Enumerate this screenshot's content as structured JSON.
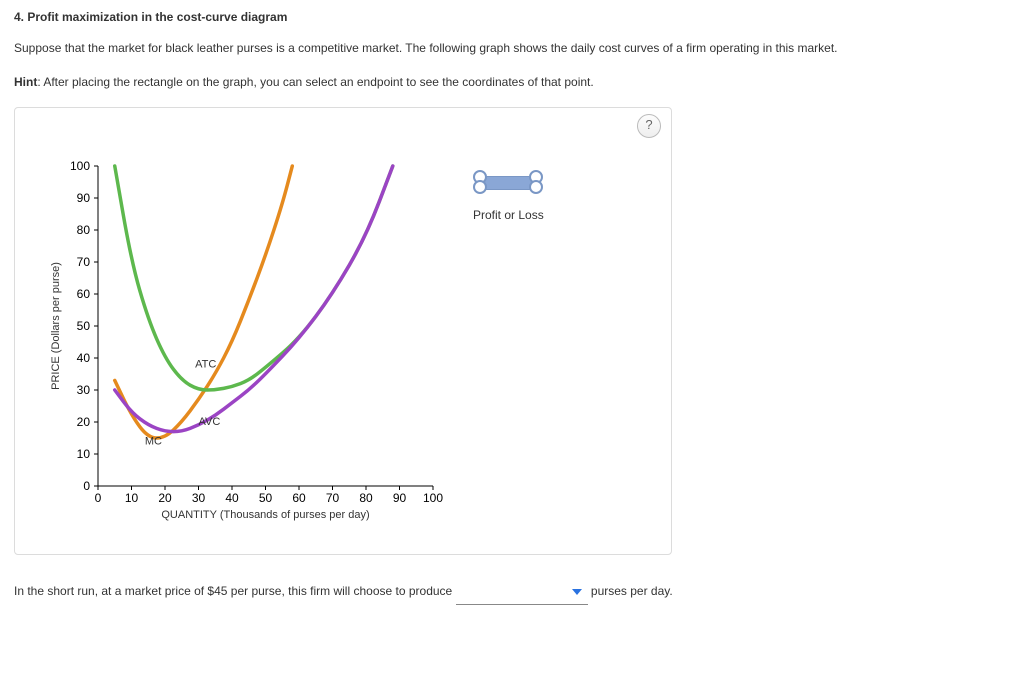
{
  "question": {
    "number_title": "4. Profit maximization in the cost-curve diagram",
    "prompt": "Suppose that the market for black leather purses is a competitive market. The following graph shows the daily cost curves of a firm operating in this market.",
    "hint_label": "Hint",
    "hint_text": ": After placing the rectangle on the graph, you can select an endpoint to see the coordinates of that point."
  },
  "help_btn": "?",
  "legend": {
    "label": "Profit or Loss"
  },
  "answer": {
    "before": "In the short run, at a market price of $45 per purse, this firm will choose to produce ",
    "after": " purses per day."
  },
  "chart_data": {
    "type": "line",
    "title": "",
    "xlabel": "QUANTITY (Thousands of purses per day)",
    "ylabel": "PRICE (Dollars per purse)",
    "xlim": [
      0,
      100
    ],
    "ylim": [
      0,
      100
    ],
    "x_ticks": [
      0,
      10,
      20,
      30,
      40,
      50,
      60,
      70,
      80,
      90,
      100
    ],
    "y_ticks": [
      0,
      10,
      20,
      30,
      40,
      50,
      60,
      70,
      80,
      90,
      100
    ],
    "series": [
      {
        "name": "MC",
        "color": "#e58a1e",
        "points": [
          {
            "x": 5,
            "y": 33
          },
          {
            "x": 10,
            "y": 22
          },
          {
            "x": 15,
            "y": 15
          },
          {
            "x": 20,
            "y": 15
          },
          {
            "x": 25,
            "y": 20
          },
          {
            "x": 30,
            "y": 27
          },
          {
            "x": 35,
            "y": 35
          },
          {
            "x": 40,
            "y": 45
          },
          {
            "x": 45,
            "y": 58
          },
          {
            "x": 50,
            "y": 72
          },
          {
            "x": 55,
            "y": 88
          },
          {
            "x": 58,
            "y": 100
          }
        ]
      },
      {
        "name": "ATC",
        "color": "#5db84d",
        "points": [
          {
            "x": 5,
            "y": 100
          },
          {
            "x": 10,
            "y": 70
          },
          {
            "x": 15,
            "y": 52
          },
          {
            "x": 20,
            "y": 40
          },
          {
            "x": 25,
            "y": 33
          },
          {
            "x": 30,
            "y": 30
          },
          {
            "x": 35,
            "y": 30
          },
          {
            "x": 40,
            "y": 31
          },
          {
            "x": 45,
            "y": 33
          },
          {
            "x": 50,
            "y": 37
          },
          {
            "x": 60,
            "y": 46
          },
          {
            "x": 70,
            "y": 60
          },
          {
            "x": 80,
            "y": 78
          },
          {
            "x": 88,
            "y": 100
          }
        ]
      },
      {
        "name": "AVC",
        "color": "#9b44c4",
        "points": [
          {
            "x": 5,
            "y": 30
          },
          {
            "x": 10,
            "y": 23
          },
          {
            "x": 15,
            "y": 19
          },
          {
            "x": 20,
            "y": 17
          },
          {
            "x": 25,
            "y": 17
          },
          {
            "x": 30,
            "y": 19
          },
          {
            "x": 35,
            "y": 22
          },
          {
            "x": 40,
            "y": 26
          },
          {
            "x": 45,
            "y": 30
          },
          {
            "x": 50,
            "y": 35
          },
          {
            "x": 60,
            "y": 46
          },
          {
            "x": 70,
            "y": 60
          },
          {
            "x": 80,
            "y": 78
          },
          {
            "x": 88,
            "y": 100
          }
        ]
      }
    ],
    "curve_labels": [
      {
        "text": "MC",
        "x": 14,
        "y": 13
      },
      {
        "text": "ATC",
        "x": 29,
        "y": 37
      },
      {
        "text": "AVC",
        "x": 30,
        "y": 19
      }
    ]
  }
}
